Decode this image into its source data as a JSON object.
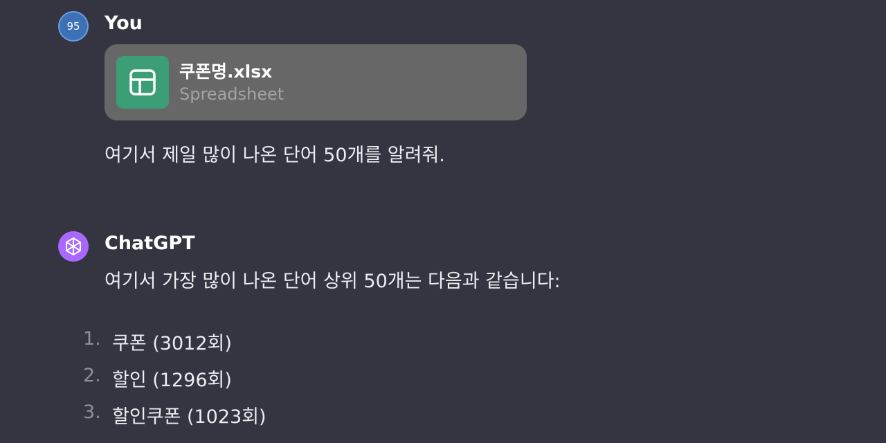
{
  "user": {
    "avatar_text": "95",
    "name": "You",
    "attachment": {
      "file_name": "쿠폰명.xlsx",
      "file_type": "Spreadsheet",
      "icon": "spreadsheet-icon",
      "icon_color": "#3c9e77"
    },
    "message": "여기서 제일 많이 나온 단어 50개를 알려줘."
  },
  "assistant": {
    "name": "ChatGPT",
    "avatar_icon": "openai-logo-icon",
    "avatar_color": "#ab68ff",
    "intro": "여기서 가장 많이 나온 단어 상위 50개는 다음과 같습니다:",
    "items": [
      {
        "num": "1.",
        "text": "쿠폰 (3012회)"
      },
      {
        "num": "2.",
        "text": "할인 (1296회)"
      },
      {
        "num": "3.",
        "text": "할인쿠폰 (1023회)"
      }
    ]
  },
  "colors": {
    "background": "#343541",
    "card": "#676767",
    "user_avatar": "#3c71b6"
  }
}
